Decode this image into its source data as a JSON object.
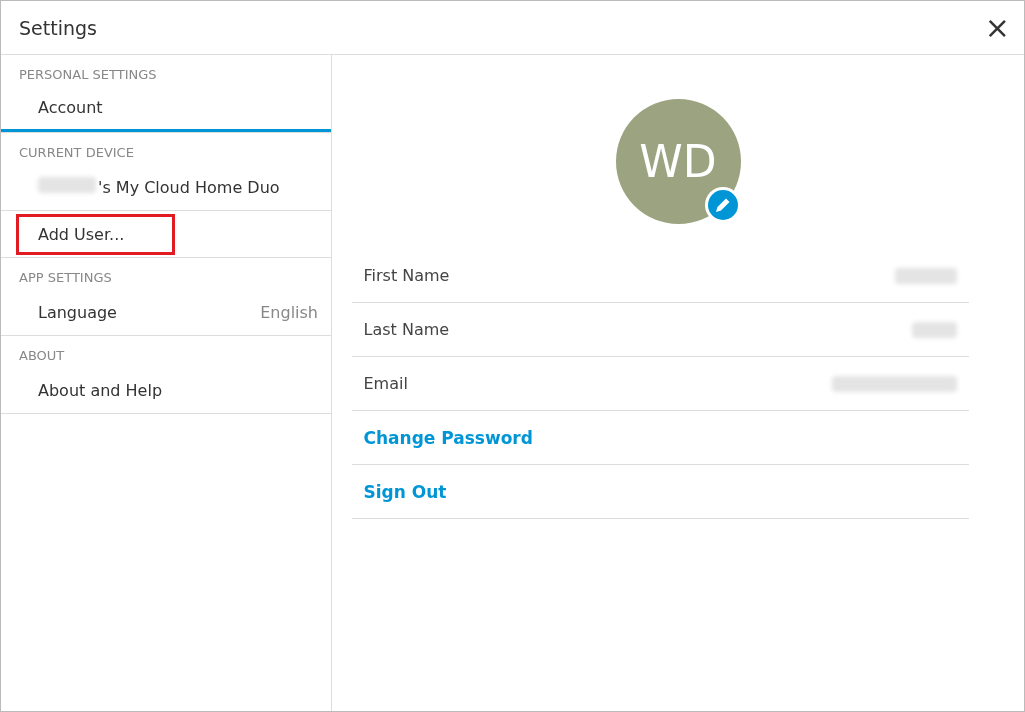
{
  "window": {
    "title": "Settings",
    "close": "×"
  },
  "sidebar": {
    "sections": [
      {
        "heading": "PERSONAL SETTINGS",
        "items": [
          {
            "label": "Account",
            "selected": true,
            "highlighted": false
          }
        ]
      },
      {
        "heading": "CURRENT DEVICE",
        "items": [
          {
            "label": "'s My Cloud Home Duo",
            "selected": false,
            "highlighted": false,
            "owner_redacted": true
          },
          {
            "label": "Add User...",
            "selected": false,
            "highlighted": true
          }
        ]
      },
      {
        "heading": "APP SETTINGS",
        "items": [
          {
            "label": "Language",
            "value": "English",
            "selected": false,
            "highlighted": false
          }
        ]
      },
      {
        "heading": "ABOUT",
        "items": [
          {
            "label": "About and Help",
            "selected": false,
            "highlighted": false
          }
        ]
      }
    ]
  },
  "profile": {
    "initials": "WD",
    "fields": [
      {
        "kind": "field",
        "label": "First Name",
        "value_redacted": true
      },
      {
        "kind": "field",
        "label": "Last Name",
        "value_redacted": true
      },
      {
        "kind": "field",
        "label": "Email",
        "value_redacted": true
      },
      {
        "kind": "link",
        "label": "Change Password"
      },
      {
        "kind": "link",
        "label": "Sign Out"
      }
    ]
  }
}
